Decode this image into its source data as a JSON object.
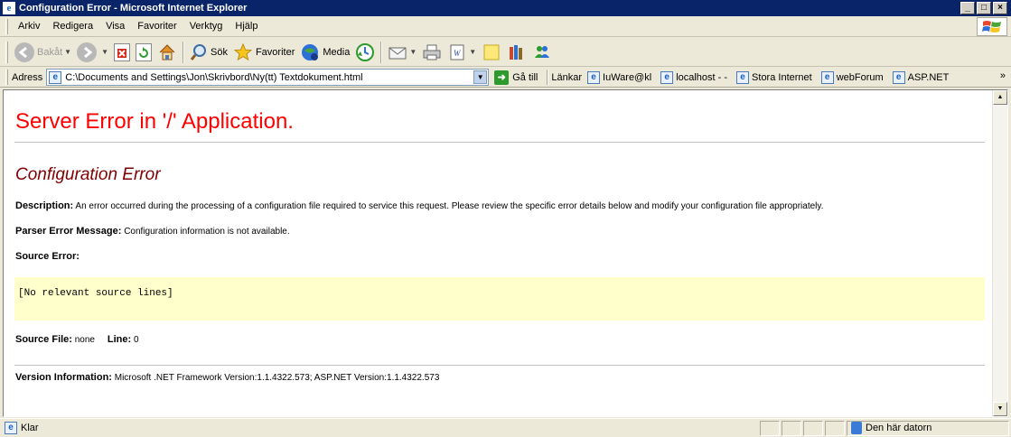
{
  "window": {
    "title": "Configuration Error - Microsoft Internet Explorer",
    "controls": [
      "_",
      "□",
      "×"
    ]
  },
  "menu": [
    "Arkiv",
    "Redigera",
    "Visa",
    "Favoriter",
    "Verktyg",
    "Hjälp"
  ],
  "toolbar": {
    "back": "Bakåt",
    "search": "Sök",
    "favorites": "Favoriter",
    "media": "Media"
  },
  "address": {
    "label": "Adress",
    "url": "C:\\Documents and Settings\\Jon\\Skrivbord\\Ny(tt) Textdokument.html",
    "go": "Gå till",
    "links_label": "Länkar",
    "links": [
      "IuWare@kl",
      "localhost - -",
      "Stora Internet",
      "webForum",
      "ASP.NET"
    ],
    "overflow": "»"
  },
  "page": {
    "heading": "Server Error in '/' Application.",
    "subheading": "Configuration Error",
    "description_label": "Description:",
    "description": "An error occurred during the processing of a configuration file required to service this request. Please review the specific error details below and modify your configuration file appropriately.",
    "parser_label": "Parser Error Message:",
    "parser_message": "Configuration information is not available.",
    "source_error_label": "Source Error:",
    "source_lines": "[No relevant source lines]",
    "source_file_label": "Source File:",
    "source_file": "none",
    "line_label": "Line:",
    "line": "0",
    "version_label": "Version Information:",
    "version": "Microsoft .NET Framework Version:1.1.4322.573; ASP.NET Version:1.1.4322.573"
  },
  "status": {
    "text": "Klar",
    "zone": "Den här datorn"
  },
  "colors": {
    "heading": "#ff0000",
    "subheading": "#800000",
    "source_box": "#ffffcc",
    "title_bar": "#0a246a"
  }
}
